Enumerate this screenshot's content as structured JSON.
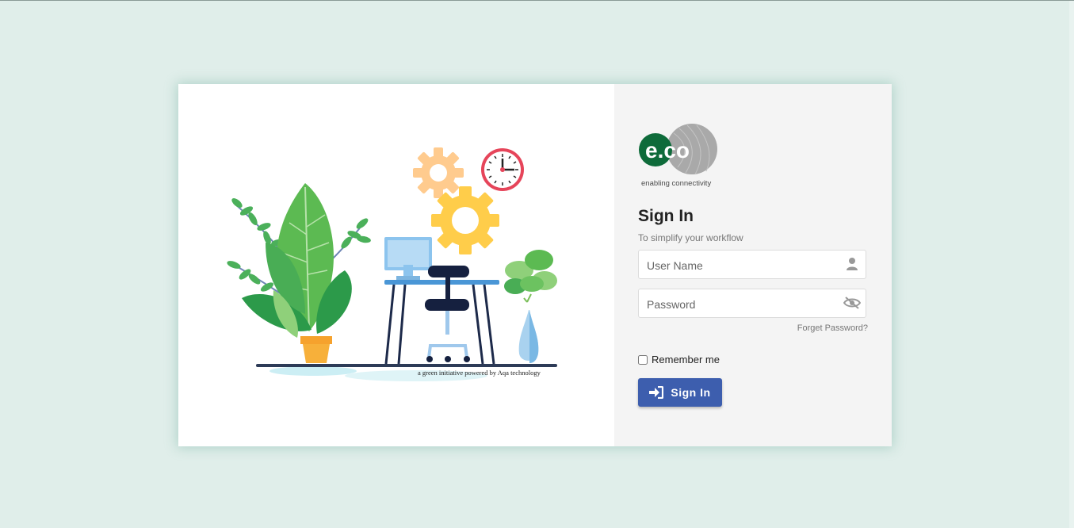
{
  "illustration": {
    "caption": "a green initiative powered by Aqa technology"
  },
  "logo": {
    "brand": "e.co",
    "tagline": "enabling connectivity",
    "colors": {
      "green": "#0e6b3a",
      "gray": "#a9a9a9"
    }
  },
  "form": {
    "title": "Sign In",
    "subtitle": "To simplify your workflow",
    "username_placeholder": "User Name",
    "username_icon": "user-icon",
    "password_placeholder": "Password",
    "password_icon": "eye-slash-icon",
    "forgot_label": "Forget Password?",
    "remember_label": "Remember me",
    "remember_checked": false,
    "signin_label": "Sign In",
    "signin_icon": "sign-in-icon",
    "button_color": "#3d5eae"
  }
}
